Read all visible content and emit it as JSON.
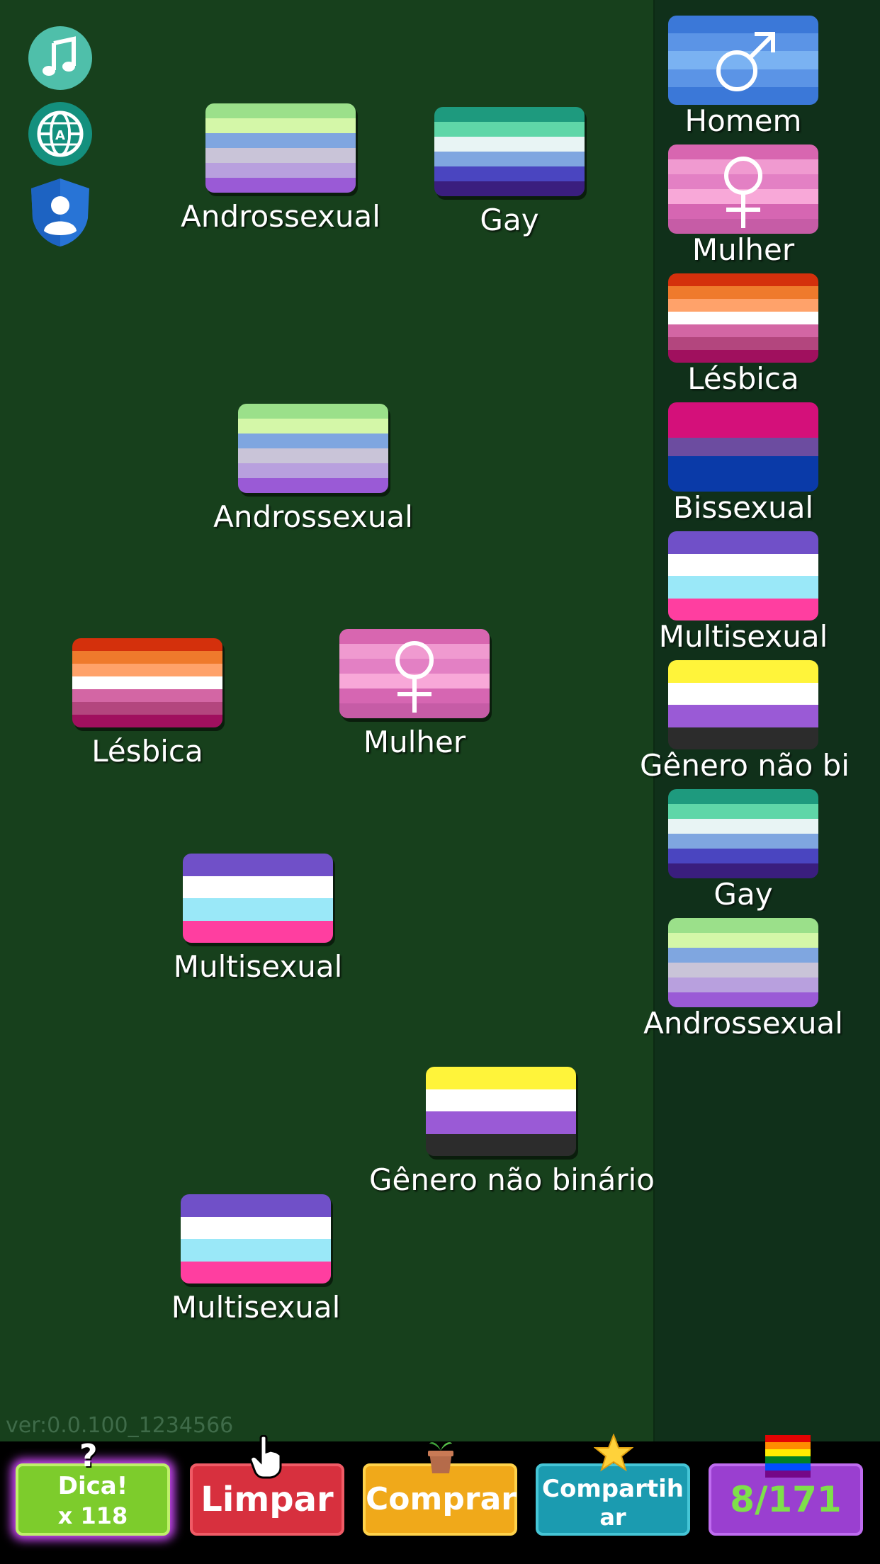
{
  "app": {
    "version": "ver:0.0.100_1234566"
  },
  "icons": {
    "music": "music-note-icon",
    "language": "globe-language-icon",
    "privacy": "shield-user-icon",
    "pointer": "hand-pointer-icon"
  },
  "board": {
    "tiles": [
      {
        "label": "Androssexual"
      },
      {
        "label": "Gay"
      },
      {
        "label": "Androssexual"
      },
      {
        "label": "Lésbica"
      },
      {
        "label": "Mulher"
      },
      {
        "label": "Multisexual"
      },
      {
        "label": "Gênero não binário"
      },
      {
        "label": "Multisexual"
      }
    ]
  },
  "sidebar": {
    "items": [
      {
        "label": "Homem"
      },
      {
        "label": "Mulher"
      },
      {
        "label": "Lésbica"
      },
      {
        "label": "Bissexual"
      },
      {
        "label": "Multisexual"
      },
      {
        "label": "Gênero não binário"
      },
      {
        "label": "Gay"
      },
      {
        "label": "Androssexual"
      }
    ]
  },
  "bottom": {
    "hint_label": "Dica!",
    "hint_count": "x 118",
    "clear_label": "Limpar",
    "buy_label": "Comprar",
    "share_label_1": "Compartih",
    "share_label_2": "ar",
    "progress": "8/171"
  },
  "colors": {
    "background": "#17401c",
    "sidebar": "#10301a",
    "androssexual": [
      "#9be08a",
      "#d4f7a8",
      "#7fa6e0",
      "#c9c4d8",
      "#b8a0de",
      "#9a5ad6"
    ],
    "gay": [
      "#1e9a7e",
      "#5fd6a8",
      "#e8f4f4",
      "#7fa6e0",
      "#4a45c0",
      "#3a1e7e"
    ],
    "lesbica": [
      "#d4300c",
      "#ef7a2c",
      "#ffa26a",
      "#ffffff",
      "#d366a4",
      "#b3467e",
      "#a0105e"
    ],
    "mulher": [
      "#d866b0",
      "#f09ad0",
      "#e380c4",
      "#f8a8d8",
      "#d666b2",
      "#c65ca6"
    ],
    "homem": [
      "#3b78d8",
      "#5b94e6",
      "#7ab2f2",
      "#5b94e6",
      "#3b78d8"
    ],
    "bissexual": [
      "#d4107a",
      "#d4107a",
      "#6c4ca0",
      "#0a3aa8",
      "#0a3aa8"
    ],
    "multisexual": [
      "#7050c8",
      "#ffffff",
      "#9ae8f8",
      "#ff3ea0"
    ],
    "naobinario": [
      "#fff43a",
      "#ffffff",
      "#9a5ad6",
      "#2c2c2c"
    ]
  }
}
